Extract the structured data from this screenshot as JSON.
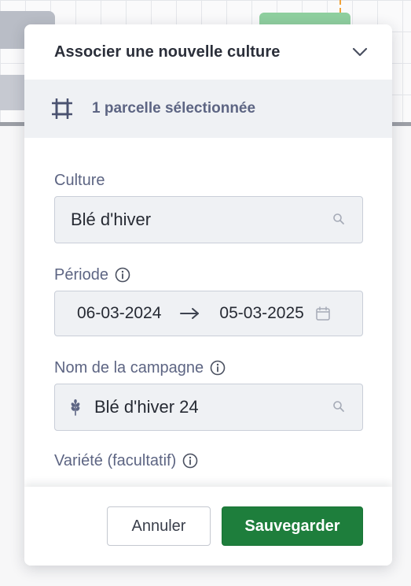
{
  "panel": {
    "title": "Associer une nouvelle culture",
    "selection_text": "1 parcelle sélectionnée"
  },
  "form": {
    "culture": {
      "label": "Culture",
      "value": "Blé d'hiver"
    },
    "period": {
      "label": "Période",
      "start": "06-03-2024",
      "end": "05-03-2025"
    },
    "campaign": {
      "label": "Nom de la campagne",
      "value": "Blé d'hiver 24"
    },
    "variety": {
      "label": "Variété (facultatif)"
    }
  },
  "footer": {
    "cancel_label": "Annuler",
    "save_label": "Sauvegarder"
  },
  "colors": {
    "primary": "#1e7e3c",
    "label": "#5d6583",
    "input_bg": "#eff1f4"
  }
}
